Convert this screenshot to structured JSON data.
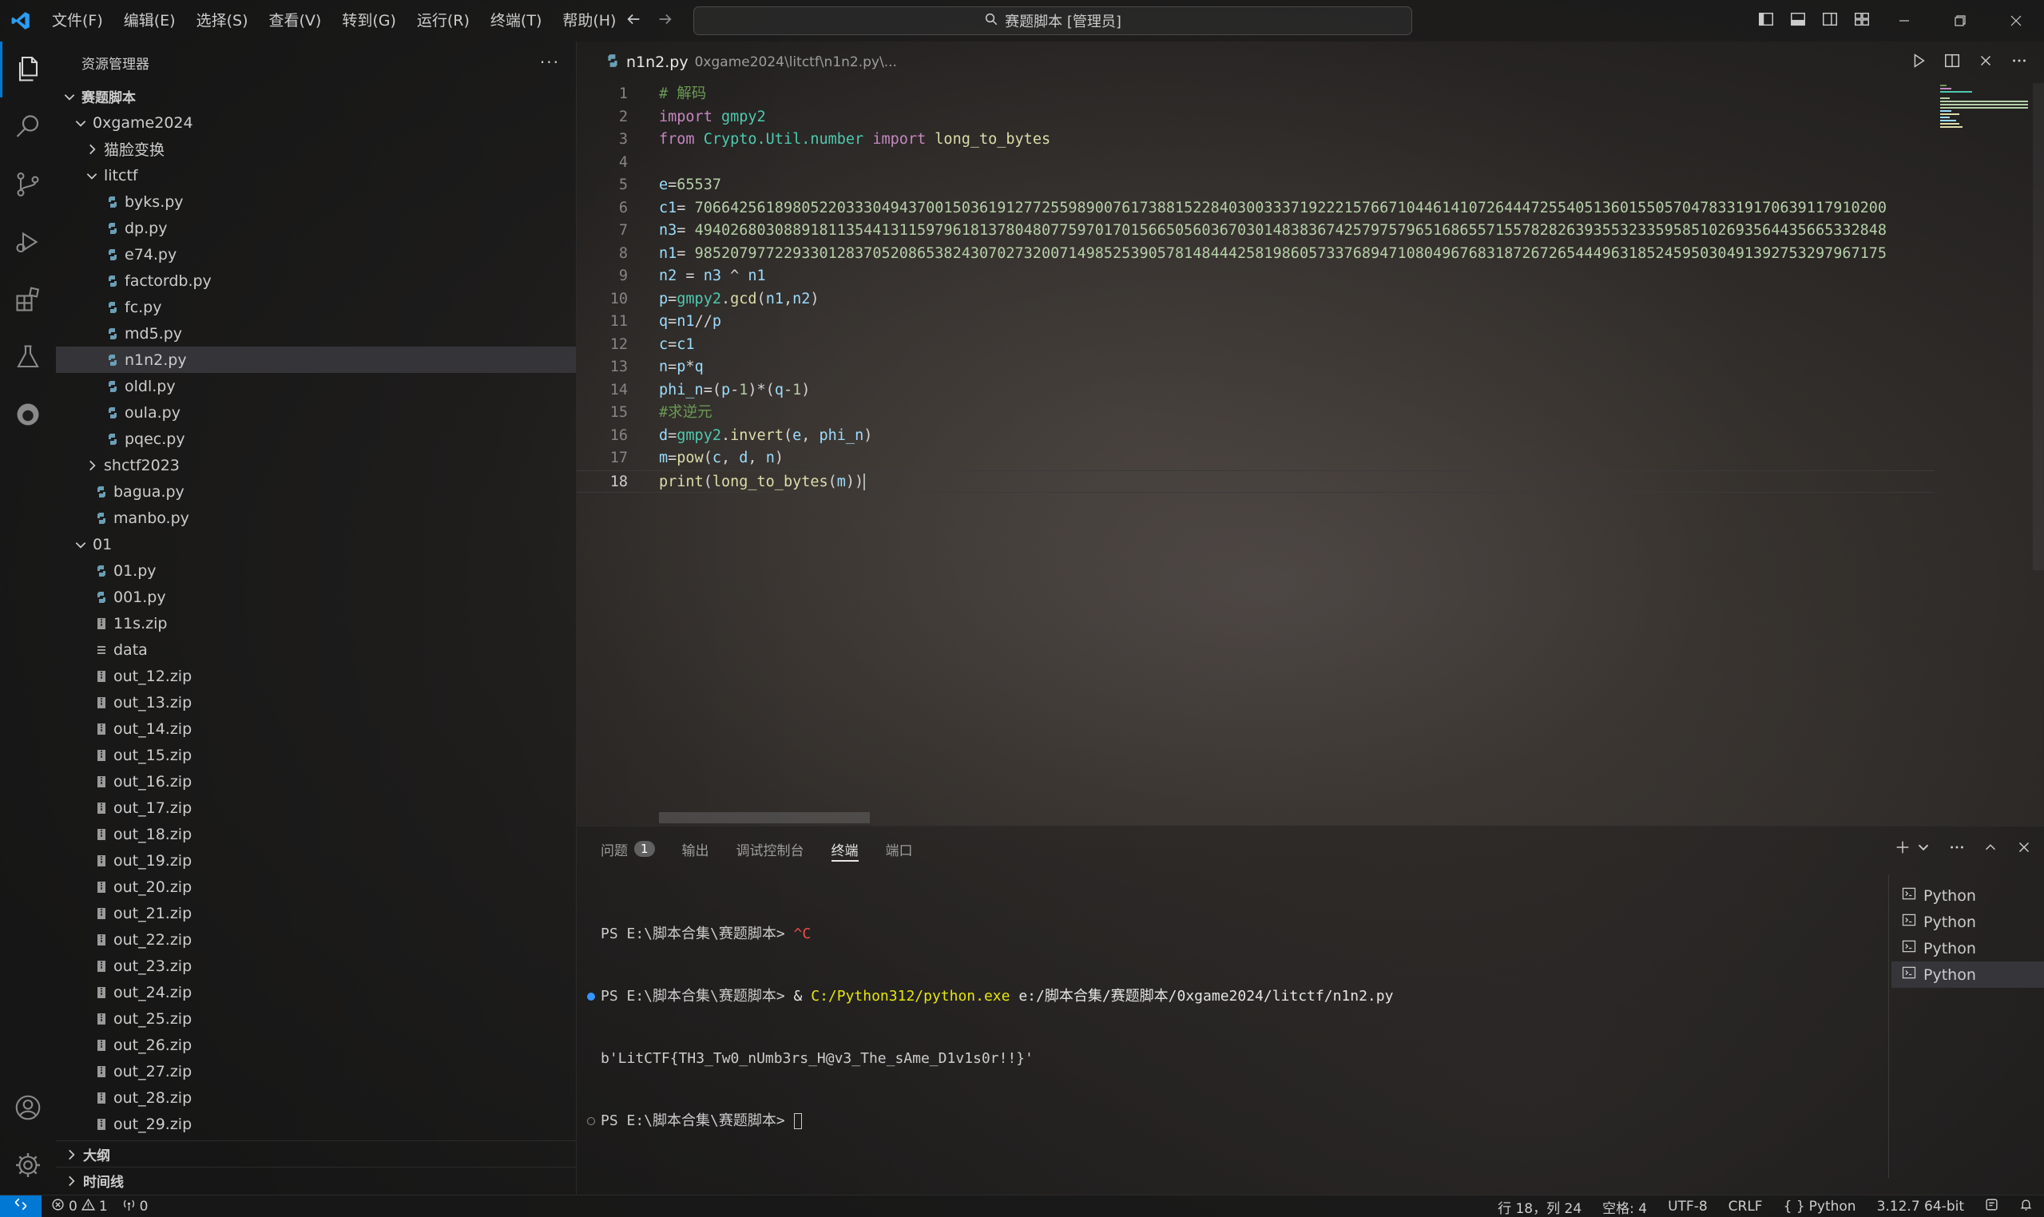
{
  "titlebar": {
    "menu": [
      "文件(F)",
      "编辑(E)",
      "选择(S)",
      "查看(V)",
      "转到(G)",
      "运行(R)",
      "终端(T)",
      "帮助(H)"
    ],
    "search_text": "赛题脚本 [管理员]"
  },
  "sidebar": {
    "title": "资源管理器",
    "more": "···",
    "root": "赛题脚本",
    "folders": {
      "game": "0xgame2024",
      "maolian": "猫脸变换",
      "litctf": "litctf",
      "shctf": "shctf2023",
      "f01": "01"
    },
    "litctf_files": [
      "byks.py",
      "dp.py",
      "e74.py",
      "factordb.py",
      "fc.py",
      "md5.py",
      "n1n2.py",
      "oldl.py",
      "oula.py",
      "pqec.py"
    ],
    "game_files": [
      "bagua.py",
      "manbo.py"
    ],
    "f01_files": [
      "01.py",
      "001.py",
      "11s.zip",
      "data",
      "out_12.zip",
      "out_13.zip",
      "out_14.zip",
      "out_15.zip",
      "out_16.zip",
      "out_17.zip",
      "out_18.zip",
      "out_19.zip",
      "out_20.zip",
      "out_21.zip",
      "out_22.zip",
      "out_23.zip",
      "out_24.zip",
      "out_25.zip",
      "out_26.zip",
      "out_27.zip",
      "out_28.zip",
      "out_29.zip"
    ],
    "outline": "大纲",
    "timeline": "时间线"
  },
  "editor": {
    "tab_name": "n1n2.py",
    "tab_path": "0xgame2024\\litctf\\n1n2.py\\...",
    "line_numbers": [
      "1",
      "2",
      "3",
      "4",
      "5",
      "6",
      "7",
      "8",
      "9",
      "10",
      "11",
      "12",
      "13",
      "14",
      "15",
      "16",
      "17",
      "18"
    ],
    "c1_value": "70664256189805220333049437001503619127725598900761738815228403003337192221576671044614107264447255405136015505704783319170639117910200",
    "n3_value": "49402680308891811354413115979618137804807759701701566505603670301483836742579757965168655715578282639355323359585102693564435665332848",
    "n1_value": "98520797722933012837052086538243070273200714985253905781484442581986057337689471080496768318726726544496318524595030491392753297967175"
  },
  "panel": {
    "tabs": [
      "问题",
      "输出",
      "调试控制台",
      "终端",
      "端口"
    ],
    "problems_count": "1",
    "terminal": {
      "prompt": "PS E:\\脚本合集\\赛题脚本> ",
      "ctrl_c": "^C",
      "amp": "& ",
      "exe": "C:/Python312/python.exe",
      "script_path": " e:/脚本合集/赛题脚本/0xgame2024/litctf/n1n2.py",
      "output": "b'LitCTF{TH3_Tw0_nUmb3rs_H@v3_The_sAme_D1v1s0r!!}'"
    },
    "terminal_list": [
      "Python",
      "Python",
      "Python",
      "Python"
    ]
  },
  "statusbar": {
    "errors": "0",
    "warnings": "1",
    "ports": "0",
    "position": "行 18，列 24",
    "spaces": "空格: 4",
    "encoding": "UTF-8",
    "eol": "CRLF",
    "language": "Python",
    "interpreter": "3.12.7 64-bit"
  },
  "colors": {
    "accent": "#0078d4",
    "comment": "#6a9955",
    "keyword": "#c586c0",
    "function": "#dcdcaa",
    "number": "#b5cea8",
    "variable": "#9cdcfe",
    "module": "#4ec9b0"
  }
}
